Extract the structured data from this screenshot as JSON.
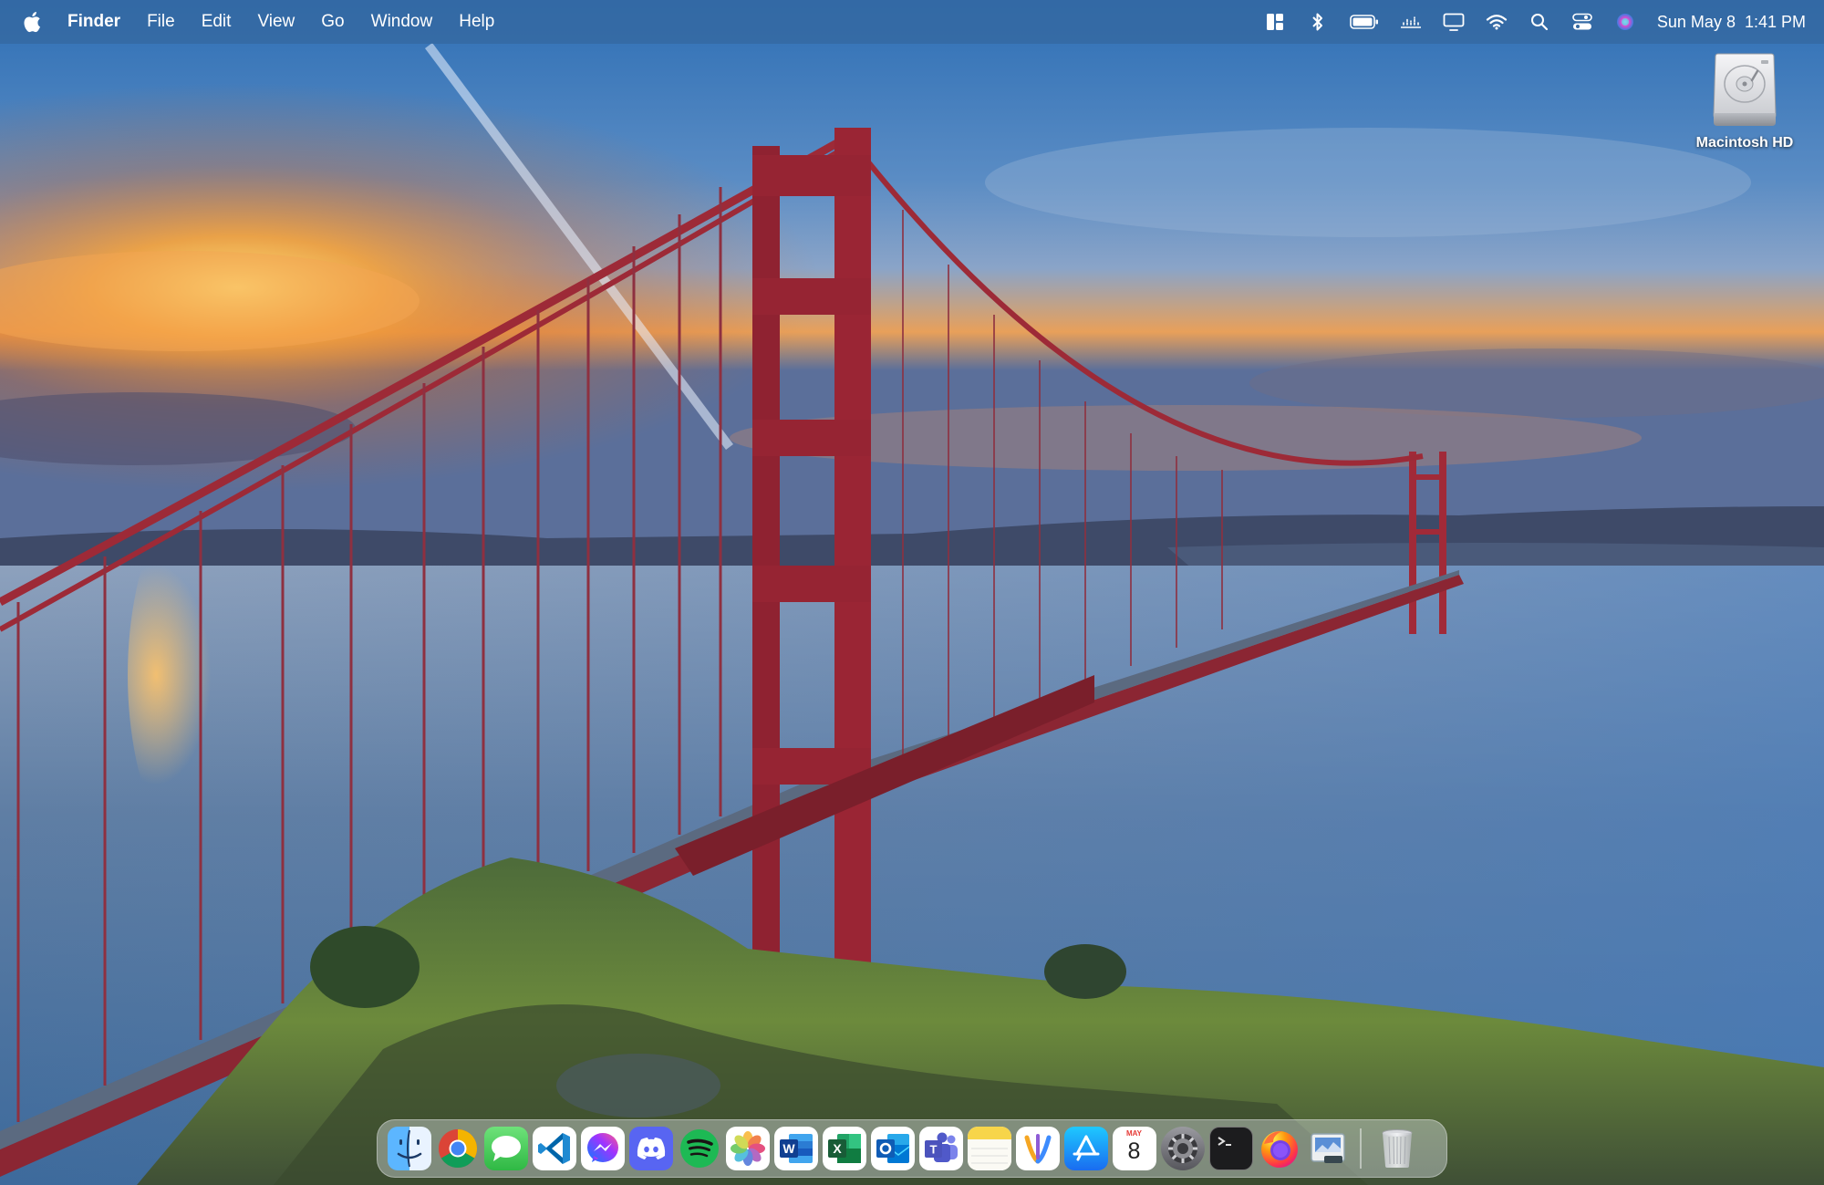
{
  "menubar": {
    "apple_icon": "apple-logo-icon",
    "app_name": "Finder",
    "menus": [
      "File",
      "Edit",
      "View",
      "Go",
      "Window",
      "Help"
    ],
    "status_icons": [
      "window-layout-icon",
      "bluetooth-icon",
      "battery-icon",
      "sound-wave-icon",
      "display-icon",
      "wifi-icon",
      "search-icon",
      "control-center-icon",
      "siri-icon"
    ],
    "date": "Sun May 8",
    "time": "1:41 PM"
  },
  "desktop": {
    "wallpaper": "golden-gate-bridge-sunset",
    "icons": [
      {
        "label": "Macintosh HD",
        "icon": "hard-drive-icon"
      }
    ]
  },
  "dock": {
    "apps": [
      {
        "name": "Finder",
        "icon": "finder-icon",
        "color": "#3b8ff0"
      },
      {
        "name": "Google Chrome",
        "icon": "chrome-icon",
        "color": "#db4437"
      },
      {
        "name": "Messages",
        "icon": "messages-icon",
        "color": "#34c759"
      },
      {
        "name": "Visual Studio Code",
        "icon": "vscode-icon",
        "color": "#1e88e5"
      },
      {
        "name": "Messenger",
        "icon": "messenger-icon",
        "color": "#8b5cf6"
      },
      {
        "name": "Discord",
        "icon": "discord-icon",
        "color": "#5865f2"
      },
      {
        "name": "Spotify",
        "icon": "spotify-icon",
        "color": "#1db954"
      },
      {
        "name": "Photos",
        "icon": "photos-icon",
        "color": "#ffffff"
      },
      {
        "name": "Microsoft Word",
        "icon": "word-icon",
        "color": "#2b579a"
      },
      {
        "name": "Microsoft Excel",
        "icon": "excel-icon",
        "color": "#217346"
      },
      {
        "name": "Microsoft Outlook",
        "icon": "outlook-icon",
        "color": "#0f6cbd"
      },
      {
        "name": "Microsoft Teams",
        "icon": "teams-icon",
        "color": "#5b5fc7"
      },
      {
        "name": "Notes",
        "icon": "notes-icon",
        "color": "#f6d84a"
      },
      {
        "name": "Freeform",
        "icon": "freeform-icon",
        "color": "#ffffff"
      },
      {
        "name": "App Store",
        "icon": "app-store-icon",
        "color": "#1a8cff"
      },
      {
        "name": "Calendar",
        "icon": "calendar-icon",
        "color": "#ffffff"
      },
      {
        "name": "System Preferences",
        "icon": "system-preferences-icon",
        "color": "#8e8e93"
      },
      {
        "name": "Terminal",
        "icon": "terminal-icon",
        "color": "#1c1c1e"
      },
      {
        "name": "Firefox",
        "icon": "firefox-icon",
        "color": "#ff7139"
      },
      {
        "name": "Preview",
        "icon": "preview-icon",
        "color": "#cfd8dc"
      }
    ],
    "calendar": {
      "month": "MAY",
      "day": "8"
    },
    "trash": {
      "name": "Trash",
      "icon": "trash-icon"
    }
  }
}
